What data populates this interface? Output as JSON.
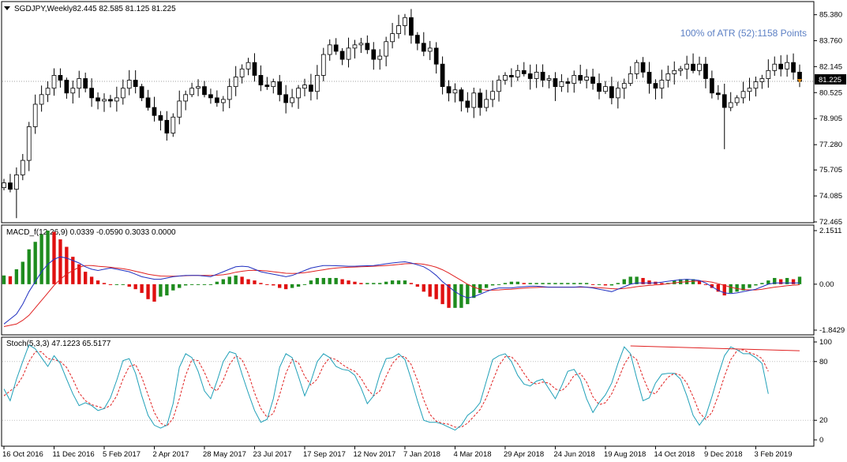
{
  "colors": {
    "background": "#ffffff",
    "frame": "#000000",
    "grid": "#c8c8c8",
    "candle_up": "#ffffff",
    "candle_down": "#000000",
    "macd_hist_up": "#1e8c1e",
    "macd_hist_down": "#e01010",
    "macd_line": "#2030c0",
    "signal_line": "#e02020",
    "stoch_main": "#20a0b8",
    "stoch_signal": "#e02020",
    "stoch_trend": "#e02020",
    "atr_text": "#5b7fc4",
    "price_badge": "#000000",
    "price_badge_text": "#ffffff"
  },
  "header": {
    "symbol_label": "SGDJPY,Weekly",
    "ohlc_label": "82.445 82.585 81.125 81.225",
    "atr_label": "100% of ATR (52):1158 Points"
  },
  "price_badge": "81.225",
  "chart_data": [
    {
      "type": "candlestick",
      "name": "SGDJPY,Weekly",
      "ylim": [
        72.465,
        86.15
      ],
      "y_ticks": [
        85.38,
        83.76,
        82.145,
        80.525,
        78.905,
        77.28,
        75.705,
        74.085,
        72.465
      ],
      "y_tick_labels": [
        "85.380",
        "83.760",
        "82.145",
        "80.525",
        "78.905",
        "77.280",
        "75.705",
        "74.085",
        "72.465"
      ],
      "x_tick_labels": [
        "16 Oct 2016",
        "11 Dec 2016",
        "5 Feb 2017",
        "2 Apr 2017",
        "28 May 2017",
        "23 Jul 2017",
        "17 Sep 2017",
        "12 Nov 2017",
        "7 Jan 2018",
        "4 Mar 2018",
        "29 Apr 2018",
        "24 Jun 2018",
        "19 Aug 2018",
        "14 Oct 2018",
        "9 Dec 2018",
        "3 Feb 2019"
      ],
      "x_tick_index": [
        0,
        8,
        16,
        24,
        32,
        40,
        48,
        56,
        64,
        72,
        80,
        88,
        96,
        104,
        112,
        120
      ],
      "last_price": 81.225,
      "close": [
        74.9,
        74.5,
        75.4,
        76.3,
        78.4,
        79.8,
        80.4,
        80.8,
        81.6,
        81.3,
        80.5,
        80.8,
        81.4,
        80.8,
        80.2,
        80.0,
        80.1,
        80.0,
        80.2,
        80.8,
        81.3,
        80.9,
        80.2,
        79.6,
        79.1,
        78.8,
        78.0,
        79.0,
        80.0,
        80.4,
        80.8,
        80.9,
        80.4,
        80.2,
        79.9,
        80.1,
        80.9,
        81.5,
        82.0,
        82.4,
        81.6,
        81.0,
        80.9,
        81.2,
        80.4,
        79.9,
        80.2,
        80.8,
        81.0,
        80.6,
        81.6,
        82.9,
        83.5,
        83.1,
        82.6,
        83.3,
        83.5,
        83.6,
        83.2,
        82.6,
        82.8,
        83.7,
        84.2,
        84.7,
        85.2,
        84.1,
        83.6,
        83.1,
        83.3,
        82.3,
        80.9,
        80.5,
        80.7,
        80.0,
        79.6,
        80.5,
        79.6,
        80.1,
        80.6,
        81.3,
        81.6,
        81.5,
        81.9,
        81.7,
        81.4,
        81.8,
        81.3,
        81.4,
        80.9,
        81.2,
        81.1,
        81.6,
        81.3,
        81.5,
        81.1,
        80.6,
        80.9,
        80.2,
        80.8,
        81.1,
        81.7,
        82.4,
        81.8,
        81.1,
        80.8,
        81.3,
        81.7,
        81.9,
        82.0,
        82.3,
        81.9,
        82.3,
        81.4,
        80.5,
        80.4,
        79.6,
        79.9,
        80.2,
        80.6,
        80.8,
        81.2,
        81.4,
        81.9,
        82.3,
        82.0,
        82.4,
        81.8,
        81.225
      ]
    },
    {
      "type": "bar",
      "name": "MACD_f",
      "label": "MACD_f(12,26,9) 0.0339 -0.0590 0.3033 0.0000",
      "ylim": [
        -1.8429,
        2.1511
      ],
      "y_ticks": [
        2.1511,
        0.0,
        -1.8429
      ],
      "y_tick_labels": [
        "2.1511",
        "0.00",
        "-1.8429"
      ],
      "histogram": [
        0.35,
        0.32,
        0.6,
        0.9,
        1.4,
        1.7,
        2.0,
        2.15,
        2.1,
        1.8,
        1.5,
        1.1,
        0.8,
        0.5,
        0.3,
        0.15,
        0.05,
        0.0,
        0.0,
        0.0,
        -0.1,
        -0.2,
        -0.35,
        -0.6,
        -0.7,
        -0.5,
        -0.45,
        -0.25,
        -0.15,
        -0.05,
        0.0,
        0.0,
        0.0,
        0.0,
        0.1,
        0.2,
        0.3,
        0.35,
        0.3,
        0.2,
        0.15,
        0.05,
        0.0,
        -0.05,
        -0.15,
        -0.2,
        -0.15,
        -0.1,
        0.0,
        0.15,
        0.25,
        0.25,
        0.25,
        0.25,
        0.2,
        0.15,
        0.1,
        0.05,
        0.05,
        0.05,
        0.05,
        0.1,
        0.15,
        0.15,
        0.15,
        0.05,
        -0.1,
        -0.3,
        -0.5,
        -0.6,
        -0.8,
        -0.95,
        -0.95,
        -0.95,
        -0.8,
        -0.55,
        -0.35,
        -0.15,
        -0.05,
        0.0,
        0.05,
        0.1,
        0.1,
        0.05,
        0.05,
        0.05,
        0.05,
        0.05,
        0.05,
        0.05,
        0.05,
        0.05,
        0.05,
        0.05,
        0.0,
        0.0,
        -0.05,
        -0.05,
        0.05,
        0.2,
        0.3,
        0.3,
        0.25,
        0.15,
        0.1,
        0.05,
        0.05,
        0.15,
        0.2,
        0.2,
        0.2,
        0.15,
        0.0,
        -0.15,
        -0.3,
        -0.45,
        -0.35,
        -0.3,
        -0.25,
        -0.15,
        -0.05,
        0.05,
        0.15,
        0.25,
        0.2,
        0.25,
        0.2,
        0.3
      ],
      "macd_line": [
        -1.6,
        -1.4,
        -1.2,
        -0.8,
        -0.3,
        0.1,
        0.5,
        0.8,
        1.0,
        1.1,
        1.05,
        0.95,
        0.85,
        0.7,
        0.6,
        0.55,
        0.6,
        0.65,
        0.6,
        0.55,
        0.5,
        0.4,
        0.3,
        0.25,
        0.2,
        0.2,
        0.25,
        0.3,
        0.33,
        0.35,
        0.35,
        0.35,
        0.33,
        0.3,
        0.4,
        0.5,
        0.6,
        0.7,
        0.72,
        0.7,
        0.6,
        0.5,
        0.45,
        0.4,
        0.35,
        0.3,
        0.35,
        0.45,
        0.55,
        0.65,
        0.7,
        0.75,
        0.75,
        0.74,
        0.73,
        0.72,
        0.72,
        0.73,
        0.74,
        0.75,
        0.78,
        0.82,
        0.85,
        0.88,
        0.9,
        0.85,
        0.78,
        0.7,
        0.55,
        0.35,
        0.1,
        -0.1,
        -0.3,
        -0.45,
        -0.55,
        -0.5,
        -0.4,
        -0.3,
        -0.2,
        -0.15,
        -0.15,
        -0.15,
        -0.12,
        -0.1,
        -0.08,
        -0.08,
        -0.1,
        -0.12,
        -0.12,
        -0.12,
        -0.12,
        -0.12,
        -0.1,
        -0.12,
        -0.15,
        -0.2,
        -0.25,
        -0.3,
        -0.2,
        -0.1,
        0.0,
        0.05,
        0.05,
        0.05,
        0.05,
        0.08,
        0.12,
        0.15,
        0.18,
        0.2,
        0.18,
        0.15,
        0.05,
        -0.1,
        -0.25,
        -0.35,
        -0.38,
        -0.35,
        -0.3,
        -0.25,
        -0.2,
        -0.1,
        0.0,
        0.05,
        0.05,
        0.05,
        0.05,
        0.05
      ],
      "signal_line": [
        -1.7,
        -1.65,
        -1.6,
        -1.45,
        -1.25,
        -0.95,
        -0.65,
        -0.35,
        -0.05,
        0.2,
        0.4,
        0.55,
        0.68,
        0.75,
        0.75,
        0.72,
        0.7,
        0.68,
        0.65,
        0.62,
        0.58,
        0.52,
        0.46,
        0.4,
        0.36,
        0.33,
        0.32,
        0.32,
        0.33,
        0.34,
        0.35,
        0.35,
        0.35,
        0.35,
        0.36,
        0.38,
        0.42,
        0.48,
        0.52,
        0.55,
        0.56,
        0.55,
        0.53,
        0.5,
        0.47,
        0.44,
        0.43,
        0.44,
        0.46,
        0.5,
        0.54,
        0.58,
        0.62,
        0.65,
        0.67,
        0.68,
        0.69,
        0.7,
        0.71,
        0.72,
        0.73,
        0.75,
        0.77,
        0.79,
        0.82,
        0.83,
        0.83,
        0.8,
        0.75,
        0.68,
        0.58,
        0.45,
        0.3,
        0.15,
        0.0,
        -0.12,
        -0.2,
        -0.24,
        -0.24,
        -0.23,
        -0.21,
        -0.2,
        -0.18,
        -0.16,
        -0.14,
        -0.13,
        -0.12,
        -0.12,
        -0.12,
        -0.12,
        -0.12,
        -0.12,
        -0.12,
        -0.12,
        -0.13,
        -0.14,
        -0.16,
        -0.18,
        -0.19,
        -0.17,
        -0.14,
        -0.1,
        -0.07,
        -0.05,
        -0.03,
        -0.01,
        0.02,
        0.05,
        0.08,
        0.1,
        0.12,
        0.13,
        0.12,
        0.08,
        0.02,
        -0.05,
        -0.12,
        -0.18,
        -0.21,
        -0.23,
        -0.23,
        -0.2,
        -0.16,
        -0.12,
        -0.09,
        -0.06,
        -0.04,
        -0.02
      ]
    },
    {
      "type": "line",
      "name": "Stoch",
      "label": "Stoch(5,3,3) 47.1223 65.5177",
      "ylim": [
        0,
        100
      ],
      "y_ticks": [
        100,
        80,
        20,
        0
      ],
      "y_tick_labels": [
        "100",
        "80",
        "20",
        "0"
      ],
      "main": [
        52,
        40,
        62,
        80,
        97,
        93,
        84,
        75,
        86,
        78,
        62,
        47,
        35,
        38,
        35,
        30,
        32,
        43,
        61,
        81,
        83,
        68,
        45,
        25,
        15,
        12,
        15,
        37,
        74,
        88,
        84,
        70,
        50,
        42,
        60,
        80,
        90,
        88,
        67,
        48,
        30,
        18,
        21,
        42,
        74,
        88,
        84,
        65,
        45,
        60,
        80,
        88,
        84,
        75,
        72,
        71,
        66,
        53,
        37,
        45,
        67,
        83,
        84,
        88,
        82,
        62,
        40,
        20,
        18,
        18,
        16,
        13,
        10,
        15,
        25,
        30,
        38,
        60,
        82,
        86,
        88,
        80,
        66,
        57,
        55,
        60,
        62,
        52,
        42,
        55,
        70,
        72,
        62,
        42,
        28,
        38,
        46,
        58,
        78,
        95,
        88,
        63,
        40,
        43,
        58,
        67,
        68,
        68,
        62,
        45,
        25,
        15,
        24,
        44,
        66,
        86,
        95,
        92,
        88,
        88,
        84,
        78,
        47
      ],
      "signal": [
        45,
        50,
        55,
        65,
        80,
        90,
        90,
        83,
        82,
        80,
        74,
        62,
        48,
        40,
        36,
        34,
        32,
        35,
        45,
        62,
        75,
        77,
        64,
        46,
        28,
        17,
        14,
        22,
        42,
        66,
        82,
        81,
        69,
        54,
        50,
        61,
        77,
        86,
        82,
        68,
        48,
        32,
        23,
        27,
        46,
        68,
        82,
        79,
        65,
        56,
        62,
        76,
        84,
        82,
        77,
        73,
        70,
        63,
        52,
        45,
        50,
        65,
        78,
        85,
        85,
        77,
        61,
        41,
        26,
        19,
        17,
        16,
        13,
        13,
        17,
        24,
        31,
        43,
        60,
        76,
        85,
        85,
        78,
        68,
        59,
        57,
        59,
        58,
        52,
        50,
        56,
        66,
        68,
        59,
        44,
        36,
        38,
        47,
        61,
        77,
        87,
        82,
        64,
        49,
        47,
        56,
        64,
        68,
        66,
        58,
        44,
        28,
        21,
        28,
        45,
        65,
        82,
        91,
        92,
        89,
        87,
        83,
        70
      ],
      "trend_line": {
        "from": [
          100,
          96
        ],
        "to": [
          127,
          91
        ]
      }
    }
  ]
}
